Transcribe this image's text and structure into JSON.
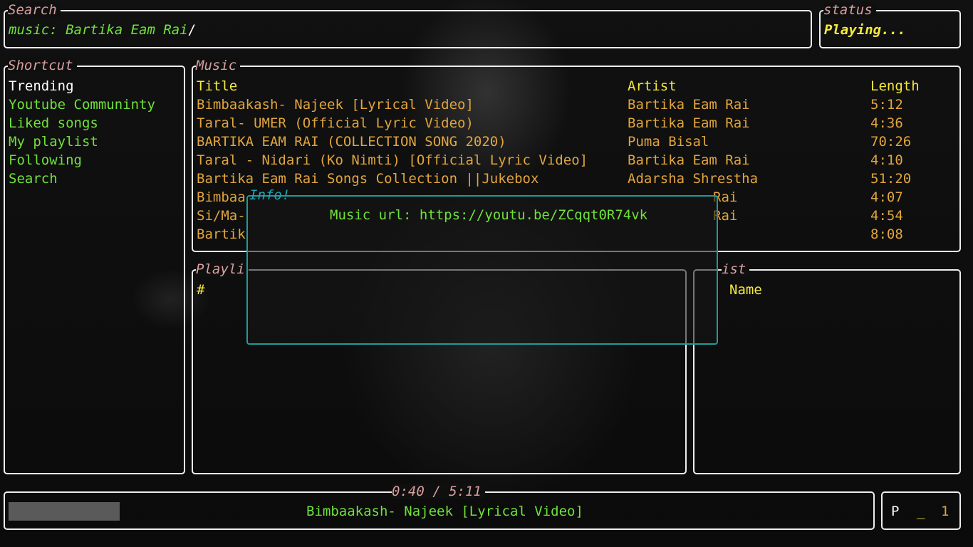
{
  "colors": {
    "border": "#eeeeee",
    "title": "#d7a0a0",
    "text_green": "#6fe23a",
    "text_amber": "#e1a53d",
    "text_yellow": "#f5e93c",
    "popup_border": "#1e9b9b"
  },
  "search": {
    "title": "Search",
    "value": "music: Bartika Eam Rai",
    "cursor": "/"
  },
  "status": {
    "title": "status",
    "value": "Playing..."
  },
  "shortcut": {
    "title": "Shortcut",
    "items": [
      "Trending",
      "Youtube Communinty",
      "Liked songs",
      "My playlist",
      "Following",
      "Search"
    ],
    "selected_index": 0
  },
  "music": {
    "title": "Music",
    "headers": {
      "title": "Title",
      "artist": "Artist",
      "length": "Length"
    },
    "rows": [
      {
        "title": "Bimbaakash- Najeek [Lyrical Video]",
        "artist": "Bartika Eam Rai",
        "length": "5:12"
      },
      {
        "title": "Taral- UMER (Official Lyric Video)",
        "artist": "Bartika Eam Rai",
        "length": "4:36"
      },
      {
        "title": "BARTIKA EAM RAI (COLLECTION SONG 2020)",
        "artist": "Puma Bisal",
        "length": "70:26"
      },
      {
        "title": "Taral - Nidari (Ko Nimti) [Official Lyric Video]",
        "artist": "Bartika Eam Rai",
        "length": "4:10"
      },
      {
        "title": "Bartika Eam Rai Songs Collection ||Jukebox",
        "artist": "Adarsha Shrestha",
        "length": "51:20"
      },
      {
        "title": "Bimbaa",
        "artist": "Rai",
        "length": "4:07"
      },
      {
        "title": "Si/Ma-",
        "artist": "Rai",
        "length": "4:54"
      },
      {
        "title": "Bartik",
        "artist": "",
        "length": "8:08"
      }
    ]
  },
  "playlist": {
    "title": "Playli",
    "header": "#"
  },
  "list": {
    "title": "ist",
    "header": "Name"
  },
  "info_popup": {
    "title": "Info!",
    "message": "Music url: https://youtu.be/ZCqqt0R74vk"
  },
  "player": {
    "time": "0:40 / 5:11",
    "now_playing": "Bimbaakash- Najeek [Lyrical Video]",
    "progress": 0.129
  },
  "mode": {
    "letter": "P",
    "separator": "_",
    "number": "1"
  }
}
